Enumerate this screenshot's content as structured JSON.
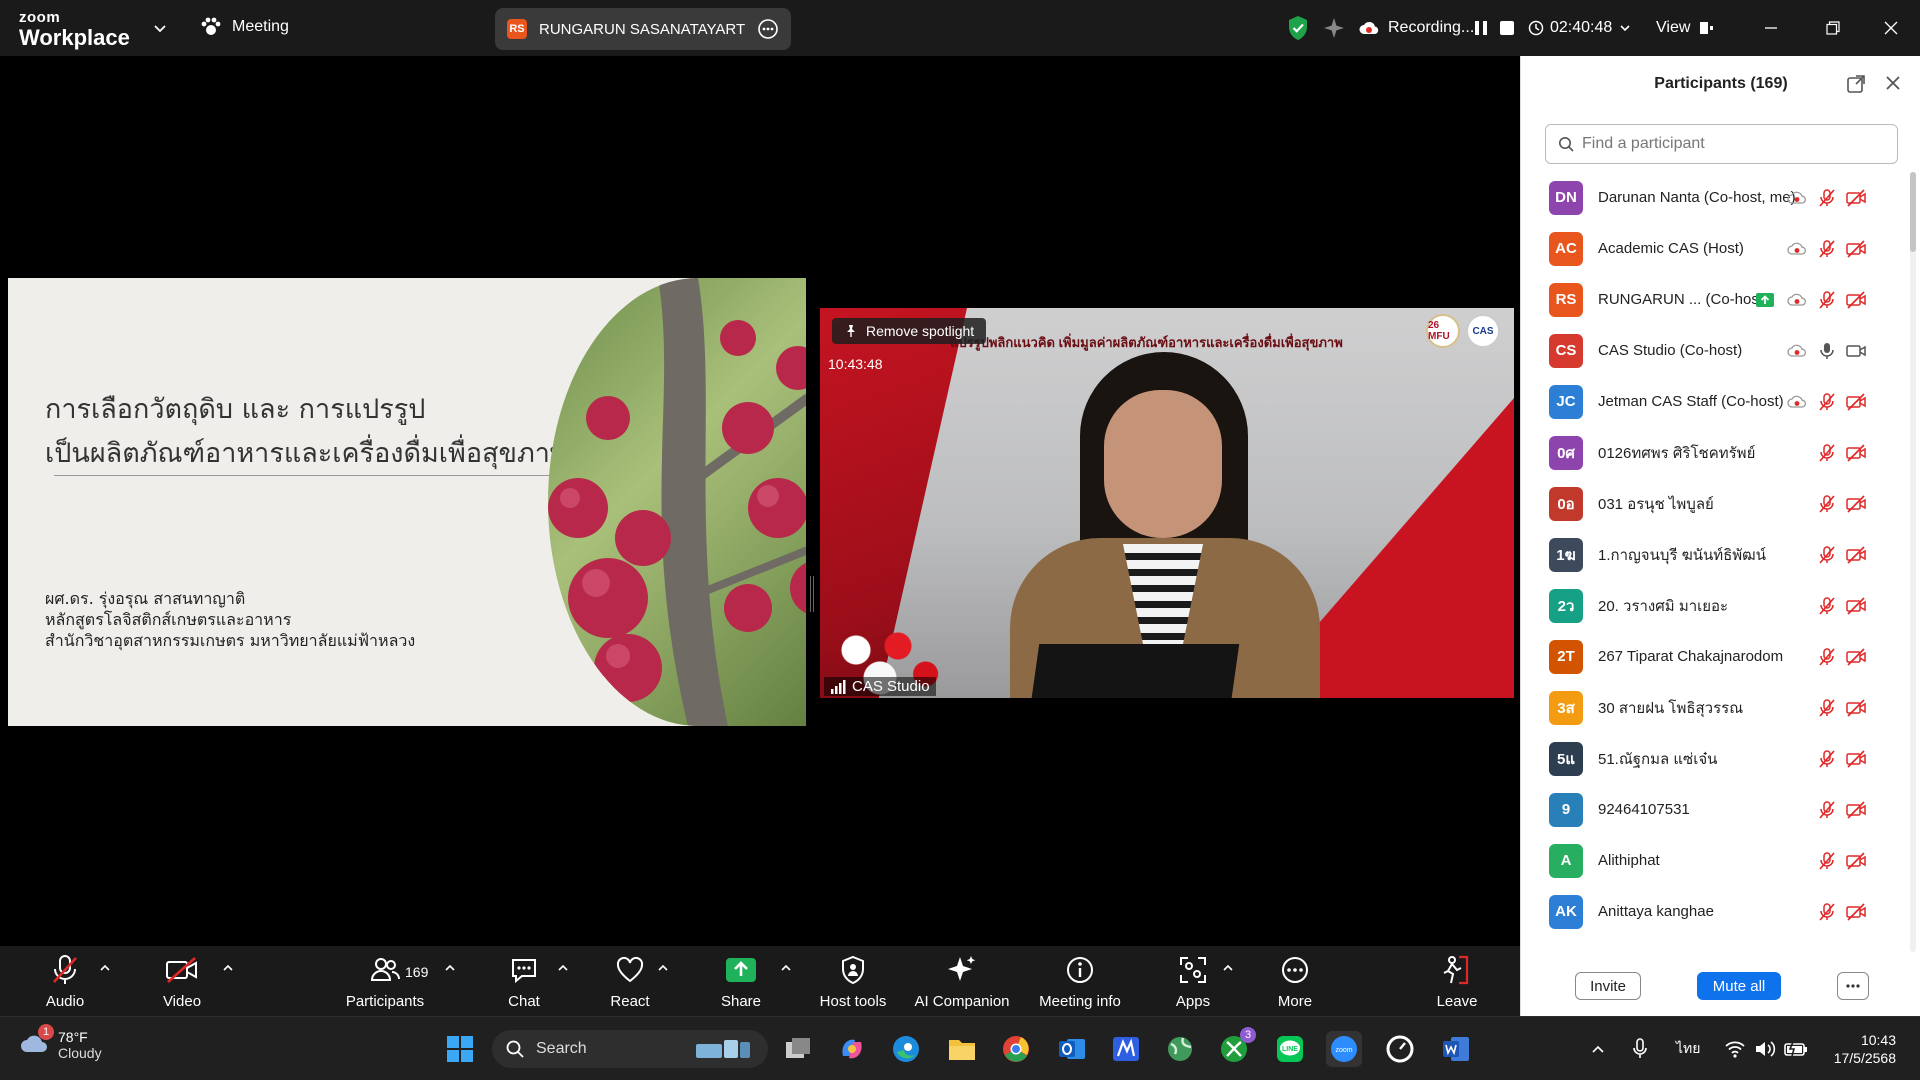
{
  "titlebar": {
    "brand_top": "zoom",
    "brand_bottom": "Workplace",
    "meeting_label": "Meeting",
    "share_badge": "RS",
    "share_name": "RUNGARUN SASANATAYART's sc",
    "recording_label": "Recording...",
    "elapsed": "02:40:48",
    "view_label": "View"
  },
  "slide": {
    "title_line1": "การเลือกวัตถุดิบ และ การแปรรูป",
    "title_line2": "เป็นผลิตภัณฑ์อาหารและเครื่องดื่มเพื่อสุขภาพ",
    "author_line1": "ผศ.ดร. รุ่งอรุณ   สาสนทาญาติ",
    "author_line2": "หลักสูตรโลจิสติกส์เกษตรและอาหาร",
    "author_line3": "สำนักวิชาอุตสาหกรรมเกษตร มหาวิทยาลัยแม่ฟ้าหลวง"
  },
  "speaker": {
    "remove_spotlight": "Remove spotlight",
    "time": "10:43:48",
    "banner": "แปรรูปพลิกแนวคิด เพิ่มมูลค่าผลิตภัณฑ์อาหารและเครื่องดื่มเพื่อสุขภาพ",
    "logo_left": "26 MFU",
    "logo_right": "CAS",
    "name": "CAS Studio"
  },
  "toolbar": {
    "audio": "Audio",
    "video": "Video",
    "participants": "Participants",
    "participants_count": "169",
    "chat": "Chat",
    "react": "React",
    "share": "Share",
    "host_tools": "Host tools",
    "ai_companion": "AI Companion",
    "meeting_info": "Meeting info",
    "apps": "Apps",
    "more": "More",
    "leave": "Leave"
  },
  "panel": {
    "title": "Participants (169)",
    "search_placeholder": "Find a participant",
    "participants": [
      {
        "initials": "DN",
        "name": "Darunan Nanta (Co-host, me)",
        "color": "#8e44ad",
        "rec": true,
        "mic": "muted",
        "cam": "off"
      },
      {
        "initials": "AC",
        "name": "Academic CAS (Host)",
        "color": "#e8561e",
        "rec": true,
        "mic": "muted",
        "cam": "off"
      },
      {
        "initials": "RS",
        "name": "RUNGARUN ... (Co-host)",
        "color": "#e8561e",
        "rec": true,
        "mic": "muted",
        "cam": "off",
        "sharing": true
      },
      {
        "initials": "CS",
        "name": "CAS Studio (Co-host)",
        "color": "#d63a2f",
        "rec": true,
        "mic": "on",
        "cam": "on"
      },
      {
        "initials": "JC",
        "name": "Jetman CAS Staff (Co-host)",
        "color": "#2d7fd6",
        "rec": true,
        "mic": "muted",
        "cam": "off"
      },
      {
        "initials": "0ศ",
        "name": "0126ทศพร ศิริโชคทรัพย์",
        "color": "#8e44ad",
        "mic": "muted",
        "cam": "off"
      },
      {
        "initials": "0อ",
        "name": "031 อรนุช ไพบูลย์",
        "color": "#c0392b",
        "mic": "muted",
        "cam": "off"
      },
      {
        "initials": "1ฆ",
        "name": "1.กาญจนบุรี ฆนันท์ธิพัฒน์",
        "color": "#3c4a5c",
        "mic": "muted",
        "cam": "off"
      },
      {
        "initials": "2ว",
        "name": "20. วรางศมิ มาเยอะ",
        "color": "#16a085",
        "mic": "muted",
        "cam": "off"
      },
      {
        "initials": "2T",
        "name": "267 Tiparat Chakajnarodom",
        "color": "#d35400",
        "mic": "muted",
        "cam": "off"
      },
      {
        "initials": "3ส",
        "name": "30 สายฝน โพธิสุวรรณ",
        "color": "#f39c12",
        "mic": "muted",
        "cam": "off"
      },
      {
        "initials": "5แ",
        "name": "51.ณัฐกมล แซ่เจ๋น",
        "color": "#2c3e50",
        "mic": "muted",
        "cam": "off"
      },
      {
        "initials": "9",
        "name": "92464107531",
        "color": "#2980b9",
        "mic": "muted",
        "cam": "off"
      },
      {
        "initials": "A",
        "name": "Alithiphat",
        "color": "#27ae60",
        "mic": "muted",
        "cam": "off"
      },
      {
        "initials": "AK",
        "name": "Anittaya kanghae",
        "color": "#2d7fd6",
        "mic": "muted",
        "cam": "off"
      }
    ],
    "invite": "Invite",
    "mute_all": "Mute all"
  },
  "taskbar": {
    "temp": "78°F",
    "condition": "Cloudy",
    "weather_badge": "1",
    "search": "Search",
    "xbox_badge": "3",
    "lang": "ไทย",
    "time": "10:43",
    "date": "17/5/2568"
  }
}
